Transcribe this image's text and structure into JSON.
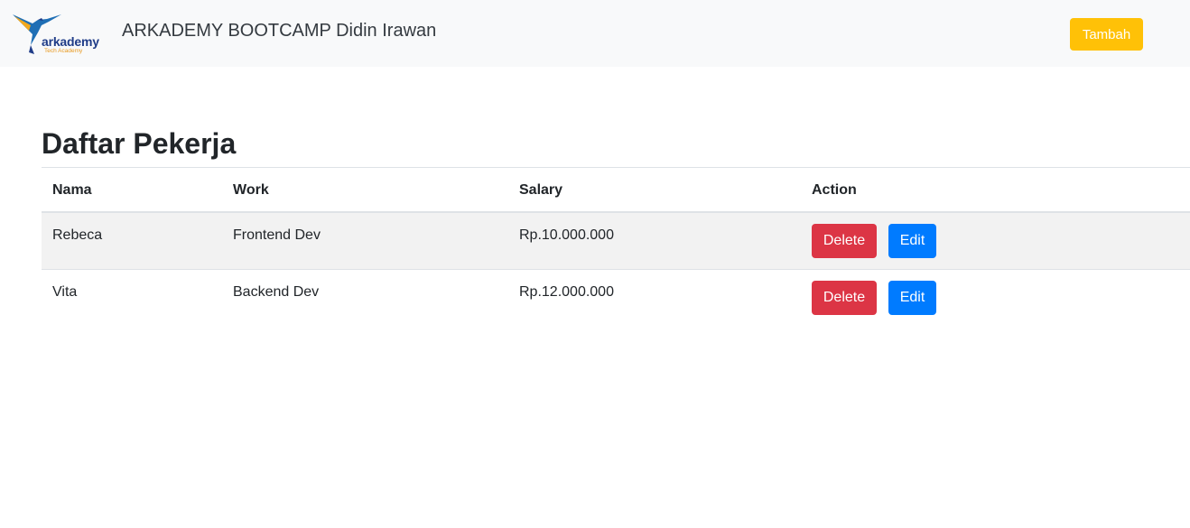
{
  "navbar": {
    "logo_word": "arkademy",
    "logo_sub": "Tech Academy",
    "title": "ARKADEMY BOOTCAMP Didin Irawan",
    "add_label": "Tambah"
  },
  "main": {
    "heading": "Daftar Pekerja",
    "columns": [
      "Nama",
      "Work",
      "Salary",
      "Action"
    ],
    "rows": [
      {
        "nama": "Rebeca",
        "work": "Frontend Dev",
        "salary": "Rp.10.000.000",
        "delete_label": "Delete",
        "edit_label": "Edit"
      },
      {
        "nama": "Vita",
        "work": "Backend Dev",
        "salary": "Rp.12.000.000",
        "delete_label": "Delete",
        "edit_label": "Edit"
      }
    ]
  },
  "colors": {
    "navbar_bg": "#f8f9fa",
    "warning": "#ffc107",
    "danger": "#dc3545",
    "primary": "#007bff"
  }
}
